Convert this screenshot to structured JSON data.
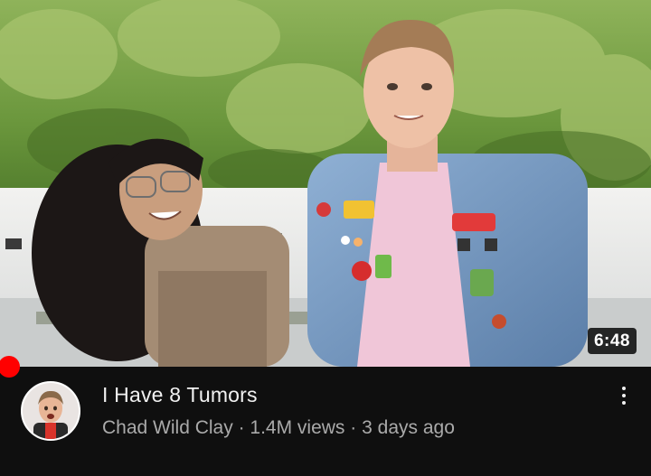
{
  "video": {
    "title": "I Have 8 Tumors",
    "duration": "6:48",
    "channel": "Chad Wild Clay",
    "views": "1.4M views",
    "separator": "·",
    "age": "3 days ago",
    "watched_progress": 0.01
  },
  "icons": {
    "menu": "more-vert-icon",
    "avatar": "channel-avatar"
  },
  "colors": {
    "background": "#0f0f0f",
    "progress": "#ff0000",
    "title": "#f1f1f1",
    "subtitle": "#aaaaaa"
  }
}
